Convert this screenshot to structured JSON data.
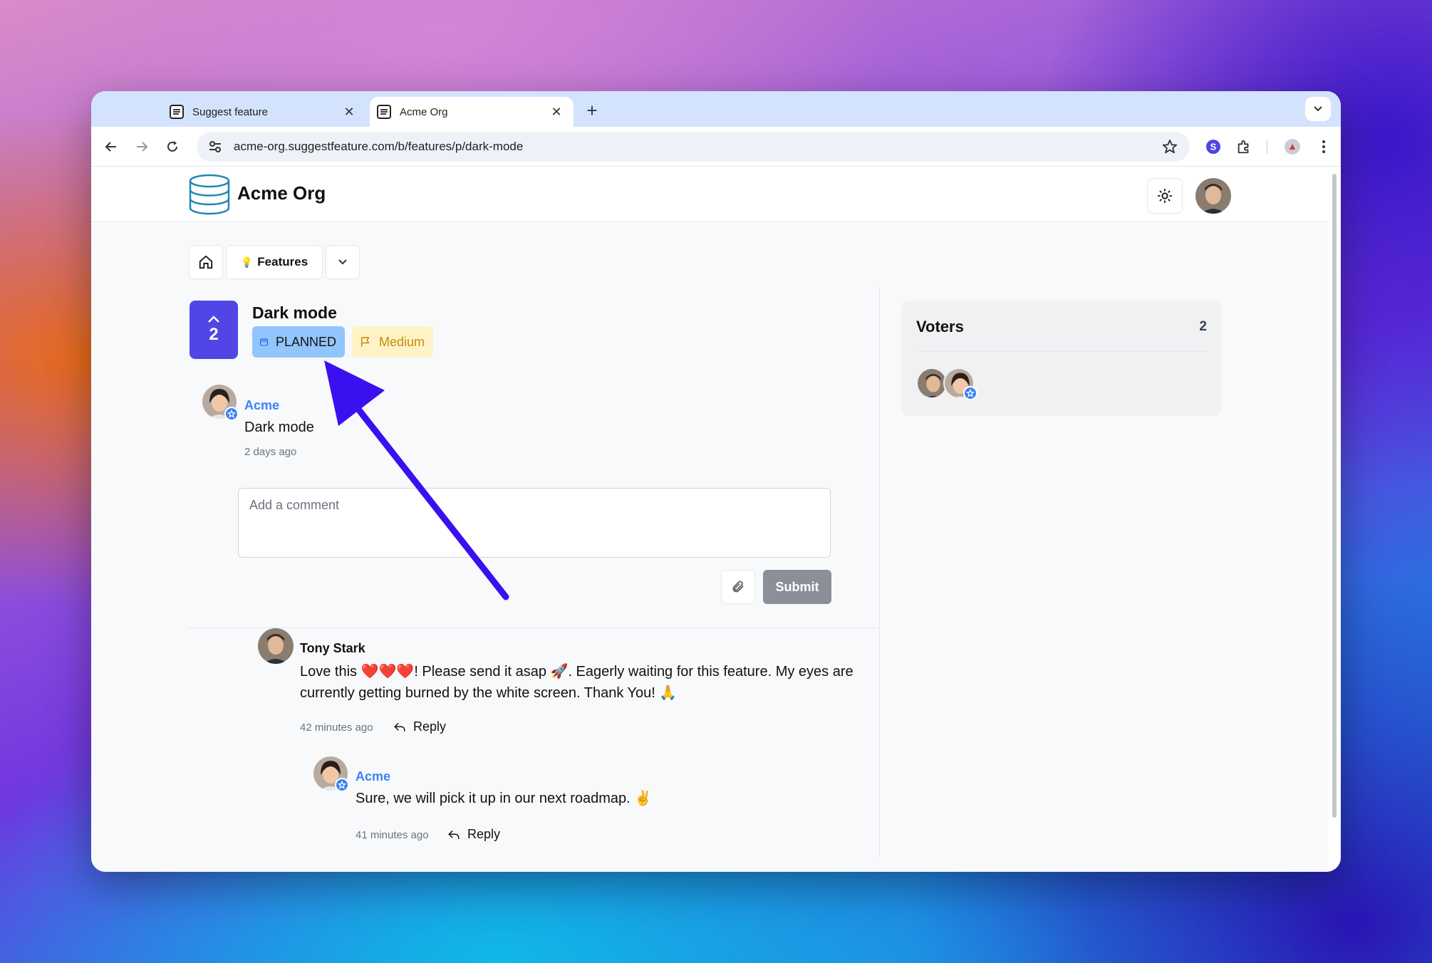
{
  "browser": {
    "tabs": [
      {
        "title": "Suggest feature",
        "active": false
      },
      {
        "title": "Acme Org",
        "active": true
      }
    ],
    "url": "acme-org.suggestfeature.com/b/features/p/dark-mode"
  },
  "site": {
    "org_name": "Acme Org"
  },
  "breadcrumb": {
    "features_icon": "💡",
    "features_label": "Features"
  },
  "post": {
    "vote_count": "2",
    "title": "Dark mode",
    "status_badge": "PLANNED",
    "priority_badge": "Medium",
    "author": "Acme",
    "body": "Dark mode",
    "time": "2 days ago"
  },
  "comment_form": {
    "placeholder": "Add a comment",
    "submit_label": "Submit"
  },
  "comments": [
    {
      "author": "Tony Stark",
      "body_line1": "Love this ❤️❤️❤️! Please send it asap 🚀. Eagerly waiting for this feature. My eyes are",
      "body_line2": "currently getting burned by the white screen. Thank You! 🙏",
      "time": "42 minutes ago",
      "reply_label": "Reply"
    },
    {
      "author": "Acme",
      "body": "Sure, we will pick it up in our next roadmap. ✌️",
      "time": "41 minutes ago",
      "reply_label": "Reply"
    }
  ],
  "voters": {
    "title": "Voters",
    "count": "2"
  },
  "colors": {
    "accent": "#4f46e5",
    "link": "#3b82f6",
    "planned_bg": "#93c5fd",
    "medium_bg": "#fef3c7",
    "medium_text": "#ca8a04",
    "annotation_arrow": "#3b10f0"
  }
}
